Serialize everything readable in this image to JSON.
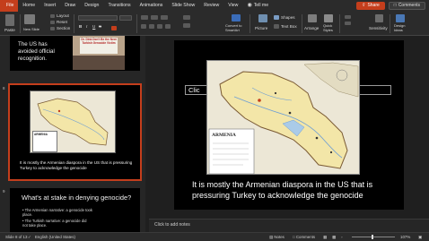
{
  "menu": {
    "tabs": [
      "File",
      "Home",
      "Insert",
      "Draw",
      "Design",
      "Transitions",
      "Animations",
      "Slide Show",
      "Review",
      "View"
    ],
    "tell_me": "Tell me",
    "share": "Share",
    "comments": "Comments"
  },
  "ribbon": {
    "paste": "Paste",
    "new_slide": "New\nSlide",
    "layout": "Layout",
    "reset": "Reset",
    "section": "Section",
    "convert_to_smartart": "Convert to\nSmartArt",
    "picture": "Picture",
    "shapes": "Shapes",
    "text_box": "Text Box",
    "arrange": "Arrange",
    "quick_styles": "Quick\nStyles",
    "sensitivity": "Sensitivity",
    "design_ideas": "Design\nIdeas"
  },
  "thumbnails": [
    {
      "text": "The US has avoided official recognition.",
      "sign_text": "Dr. Dink Don't Be the Next Turkish Genocide Victim"
    },
    {
      "number": "8",
      "caption": "It is mostly the Armenian diaspora in the US that is pressuring Turkey to acknowledge the genocide",
      "map_label": "ARMENIA"
    },
    {
      "number": "9",
      "title": "What's at stake in denying genocide?",
      "bullets": [
        "The Armenian narrative: a genocide took place.",
        "The Turkish narrative: a genocide did not take place."
      ]
    }
  ],
  "slide": {
    "placeholder": "Clic",
    "map_label": "ARMENIA",
    "text": "It is mostly the Armenian diaspora in the US that is pressuring Turkey to acknowledge the genocide"
  },
  "notes": {
    "placeholder": "Click to add notes"
  },
  "status": {
    "slide_info": "Slide 8 of 13",
    "language": "English (United States)",
    "notes": "Notes",
    "comments": "Comments",
    "zoom": "107%"
  },
  "colors": {
    "accent": "#c43e1c",
    "map_land": "#f3e6a8",
    "map_bg": "#ece7d6"
  }
}
